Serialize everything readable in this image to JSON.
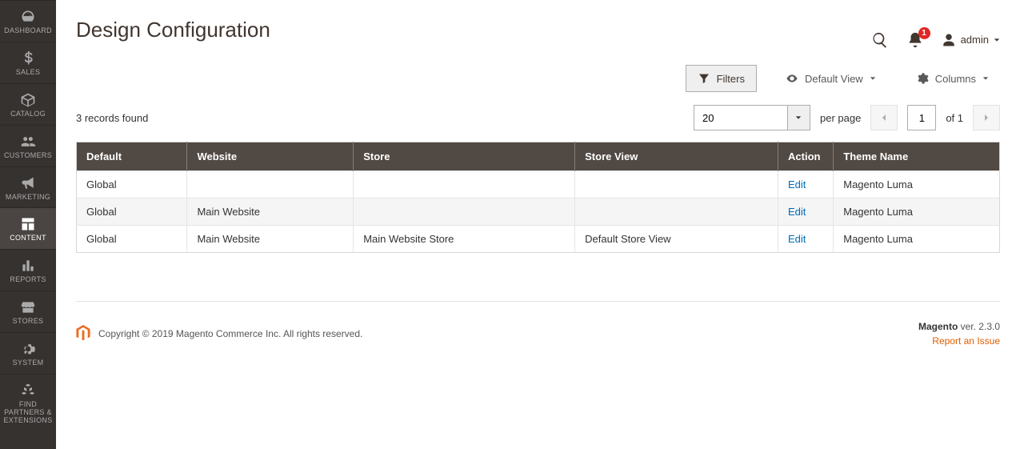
{
  "sidebar": {
    "items": [
      {
        "label": "DASHBOARD"
      },
      {
        "label": "SALES"
      },
      {
        "label": "CATALOG"
      },
      {
        "label": "CUSTOMERS"
      },
      {
        "label": "MARKETING"
      },
      {
        "label": "CONTENT"
      },
      {
        "label": "REPORTS"
      },
      {
        "label": "STORES"
      },
      {
        "label": "SYSTEM"
      },
      {
        "label": "FIND PARTNERS & EXTENSIONS"
      }
    ]
  },
  "header": {
    "title": "Design Configuration",
    "notification_count": "1",
    "username": "admin"
  },
  "toolbar": {
    "filters_label": "Filters",
    "view_label": "Default View",
    "columns_label": "Columns"
  },
  "grid": {
    "records_text": "3 records found",
    "per_page_value": "20",
    "per_page_label": "per page",
    "current_page": "1",
    "total_pages_text": "of 1",
    "columns": [
      "Default",
      "Website",
      "Store",
      "Store View",
      "Action",
      "Theme Name"
    ],
    "rows": [
      {
        "default": "Global",
        "website": "",
        "store": "",
        "store_view": "",
        "action": "Edit",
        "theme": "Magento Luma"
      },
      {
        "default": "Global",
        "website": "Main Website",
        "store": "",
        "store_view": "",
        "action": "Edit",
        "theme": "Magento Luma"
      },
      {
        "default": "Global",
        "website": "Main Website",
        "store": "Main Website Store",
        "store_view": "Default Store View",
        "action": "Edit",
        "theme": "Magento Luma"
      }
    ]
  },
  "footer": {
    "copyright": "Copyright © 2019 Magento Commerce Inc. All rights reserved.",
    "product": "Magento",
    "version": " ver. 2.3.0",
    "report": "Report an Issue"
  }
}
